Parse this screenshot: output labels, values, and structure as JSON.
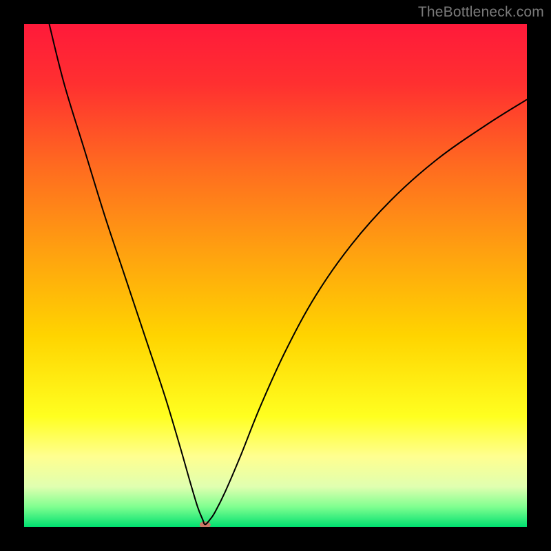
{
  "watermark": "TheBottleneck.com",
  "chart_data": {
    "type": "line",
    "title": "",
    "xlabel": "",
    "ylabel": "",
    "xlim": [
      0,
      100
    ],
    "ylim": [
      0,
      100
    ],
    "grid": false,
    "legend": false,
    "background_gradient": {
      "stops": [
        {
          "pos": 0.0,
          "color": "#ff1a3a"
        },
        {
          "pos": 0.12,
          "color": "#ff3030"
        },
        {
          "pos": 0.28,
          "color": "#ff6a20"
        },
        {
          "pos": 0.45,
          "color": "#ffa010"
        },
        {
          "pos": 0.62,
          "color": "#ffd400"
        },
        {
          "pos": 0.78,
          "color": "#ffff20"
        },
        {
          "pos": 0.86,
          "color": "#ffff90"
        },
        {
          "pos": 0.92,
          "color": "#e0ffb0"
        },
        {
          "pos": 0.96,
          "color": "#80ff90"
        },
        {
          "pos": 1.0,
          "color": "#00e070"
        }
      ]
    },
    "series": [
      {
        "name": "curve",
        "stroke": "#000000",
        "stroke_width": 2,
        "x": [
          5,
          8,
          12,
          16,
          20,
          24,
          28,
          31,
          33,
          34.5,
          35.5,
          36,
          37,
          38,
          40,
          43,
          47,
          52,
          58,
          65,
          73,
          82,
          92,
          100
        ],
        "y": [
          100,
          88,
          75,
          62,
          50,
          38,
          26,
          16,
          9,
          4,
          1.5,
          0.5,
          1.5,
          3,
          7,
          14,
          24,
          35,
          46,
          56,
          65,
          73,
          80,
          85
        ]
      }
    ],
    "marker": {
      "name": "min-point",
      "x": 36,
      "y": 0.4,
      "rx": 8,
      "ry": 5,
      "fill": "#cc7766"
    }
  }
}
